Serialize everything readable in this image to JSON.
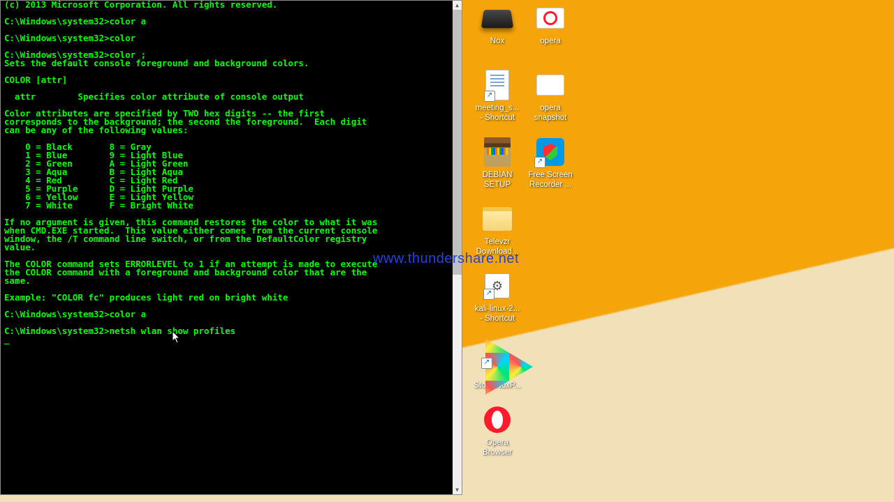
{
  "terminal": {
    "lines": [
      "(c) 2013 Microsoft Corporation. All rights reserved.",
      "",
      "C:\\Windows\\system32>color a",
      "",
      "C:\\Windows\\system32>color",
      "",
      "C:\\Windows\\system32>color ;",
      "Sets the default console foreground and background colors.",
      "",
      "COLOR [attr]",
      "",
      "  attr        Specifies color attribute of console output",
      "",
      "Color attributes are specified by TWO hex digits -- the first",
      "corresponds to the background; the second the foreground.  Each digit",
      "can be any of the following values:",
      "",
      "    0 = Black       8 = Gray",
      "    1 = Blue        9 = Light Blue",
      "    2 = Green       A = Light Green",
      "    3 = Aqua        B = Light Aqua",
      "    4 = Red         C = Light Red",
      "    5 = Purple      D = Light Purple",
      "    6 = Yellow      E = Light Yellow",
      "    7 = White       F = Bright White",
      "",
      "If no argument is given, this command restores the color to what it was",
      "when CMD.EXE started.  This value either comes from the current console",
      "window, the /T command line switch, or from the DefaultColor registry",
      "value.",
      "",
      "The COLOR command sets ERRORLEVEL to 1 if an attempt is made to execute",
      "the COLOR command with a foreground and background color that are the",
      "same.",
      "",
      "Example: \"COLOR fc\" produces light red on bright white",
      "",
      "C:\\Windows\\system32>color a",
      "",
      "C:\\Windows\\system32>netsh wlan show profiles",
      "_"
    ]
  },
  "icons": {
    "col1": [
      {
        "label": "Nox",
        "cls": "ico-nox"
      },
      {
        "label": "meeting_s...\n- Shortcut",
        "cls": "ico-doc"
      },
      {
        "label": "DEBIAN\nSETUP",
        "cls": "ico-winrar"
      },
      {
        "label": "Televzr\nDownload...",
        "cls": "ico-folder"
      },
      {
        "label": "kali-linux-2...\n- Shortcut",
        "cls": "ico-kali"
      },
      {
        "label": "Play\nStore-NoxP...",
        "cls": "ico-play"
      },
      {
        "label": "Opera\nBrowser",
        "cls": "ico-opera"
      }
    ],
    "col2": [
      {
        "label": "opera",
        "cls": "ico-opera2"
      },
      {
        "label": "opera\nsnapshot",
        "cls": "ico-zoom"
      },
      {
        "label": "Free Screen\nRecorder ...",
        "cls": "ico-shield"
      }
    ]
  },
  "watermark": "www.thundershare.net"
}
